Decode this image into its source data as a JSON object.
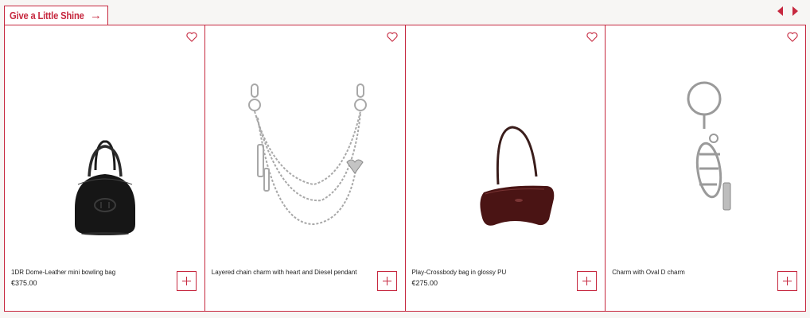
{
  "header": {
    "title": "Give a Little Shine",
    "title_arrow": "→"
  },
  "nav": {
    "prev_icon": "caret-left-icon",
    "next_icon": "caret-right-icon"
  },
  "colors": {
    "accent": "#c6283f",
    "text": "#222222"
  },
  "products": [
    {
      "name": "1DR Dome-Leather mini bowling bag",
      "price": "€375.00"
    },
    {
      "name": "Layered chain charm with heart and Diesel pendant",
      "price": ""
    },
    {
      "name": "Play-Crossbody bag in glossy PU",
      "price": "€275.00"
    },
    {
      "name": "Charm with Oval D charm",
      "price": ""
    }
  ]
}
